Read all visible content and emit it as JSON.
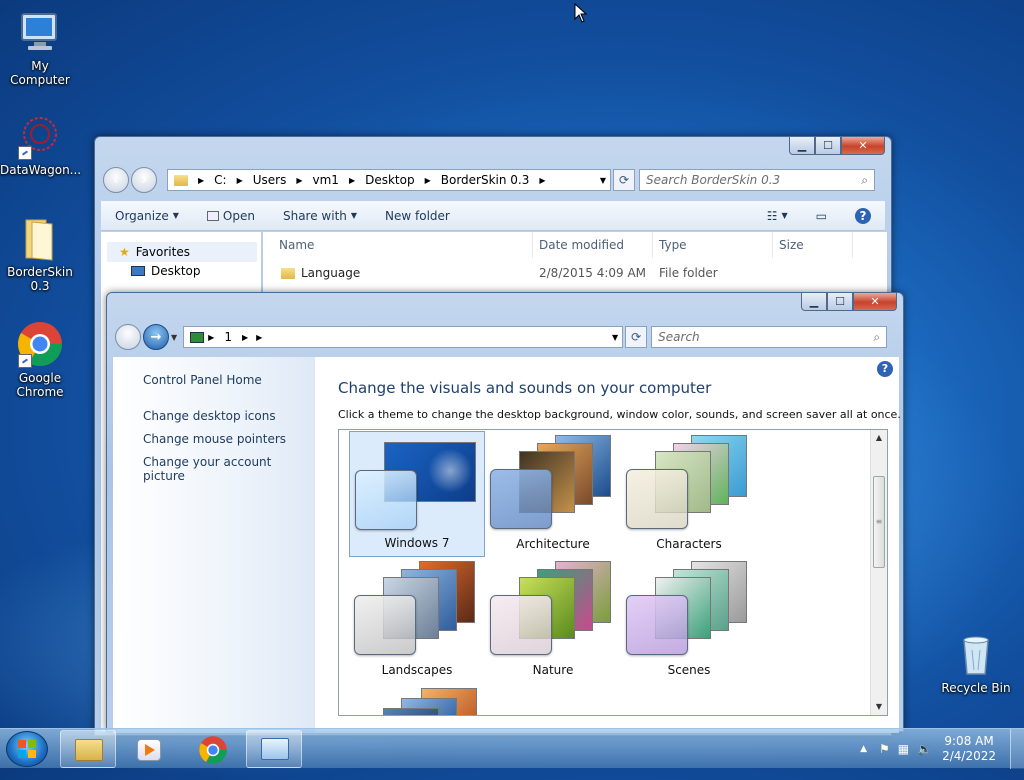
{
  "desktop": {
    "icons": [
      {
        "label": "My Computer"
      },
      {
        "label": "DataWagon..."
      },
      {
        "label": "BorderSkin 0.3"
      },
      {
        "label": "Google Chrome"
      },
      {
        "label": "Recycle Bin"
      }
    ]
  },
  "explorer": {
    "caption": {
      "min": "▁",
      "max": "☐",
      "close": "✕"
    },
    "address": {
      "path": [
        "C:",
        "Users",
        "vm1",
        "Desktop",
        "BorderSkin 0.3"
      ]
    },
    "search_placeholder": "Search BorderSkin 0.3",
    "toolbar": {
      "organize": "Organize",
      "open": "Open",
      "share": "Share with",
      "new_folder": "New folder"
    },
    "nav": {
      "favorites": "Favorites",
      "desktop": "Desktop"
    },
    "columns": {
      "name": "Name",
      "date": "Date modified",
      "type": "Type",
      "size": "Size"
    },
    "rows": [
      {
        "name": "Language",
        "date": "2/8/2015 4:09 AM",
        "type": "File folder"
      }
    ]
  },
  "personalization": {
    "caption": {
      "min": "▁",
      "max": "☐",
      "close": "✕"
    },
    "address": {
      "crumb": "1"
    },
    "search_placeholder": "Search",
    "left": {
      "home": "Control Panel Home",
      "links": [
        "Change desktop icons",
        "Change mouse pointers",
        "Change your account picture"
      ]
    },
    "title": "Change the visuals and sounds on your computer",
    "subtitle": "Click a theme to change the desktop background, window color, sounds, and screen saver all at once.",
    "themes": [
      {
        "label": "Windows 7",
        "selected": true
      },
      {
        "label": "Architecture"
      },
      {
        "label": "Characters"
      },
      {
        "label": "Landscapes"
      },
      {
        "label": "Nature"
      },
      {
        "label": "Scenes"
      }
    ]
  },
  "taskbar": {
    "clock_time": "9:08 AM",
    "clock_date": "2/4/2022"
  }
}
